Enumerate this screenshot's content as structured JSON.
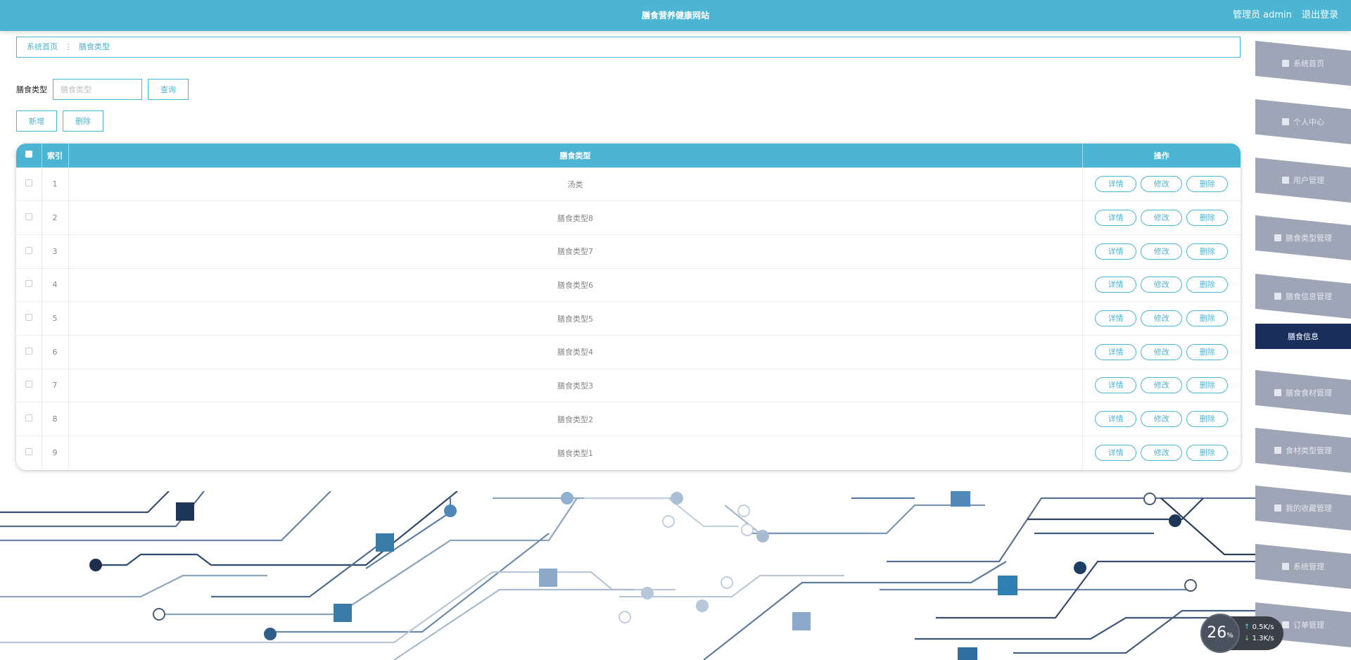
{
  "header": {
    "title": "膳食营养健康网站",
    "user": "管理员 admin",
    "logout": "退出登录"
  },
  "breadcrumb": {
    "home": "系统首页",
    "current": "膳食类型"
  },
  "search": {
    "label": "膳食类型",
    "placeholder": "膳食类型",
    "button": "查询"
  },
  "actions": {
    "add": "新增",
    "delete": "删除"
  },
  "table": {
    "headers": {
      "index": "索引",
      "type": "膳食类型",
      "ops": "操作"
    },
    "op_labels": {
      "detail": "详情",
      "edit": "修改",
      "delete": "删除"
    },
    "rows": [
      {
        "index": "1",
        "type": "汤类"
      },
      {
        "index": "2",
        "type": "膳食类型8"
      },
      {
        "index": "3",
        "type": "膳食类型7"
      },
      {
        "index": "4",
        "type": "膳食类型6"
      },
      {
        "index": "5",
        "type": "膳食类型5"
      },
      {
        "index": "6",
        "type": "膳食类型4"
      },
      {
        "index": "7",
        "type": "膳食类型3"
      },
      {
        "index": "8",
        "type": "膳食类型2"
      },
      {
        "index": "9",
        "type": "膳食类型1"
      }
    ]
  },
  "sidebar": {
    "items": [
      {
        "label": "系统首页",
        "icon": "home-icon"
      },
      {
        "label": "个人中心",
        "icon": "user-icon"
      },
      {
        "label": "用户管理",
        "icon": "briefcase-icon"
      },
      {
        "label": "膳食类型管理",
        "icon": "grid-icon"
      },
      {
        "label": "膳食信息管理",
        "icon": "grid-icon"
      },
      {
        "label": "膳食信息",
        "icon": "",
        "active": true
      },
      {
        "label": "膳食食材管理",
        "icon": "grid-icon"
      },
      {
        "label": "食材类型管理",
        "icon": "grid-icon"
      },
      {
        "label": "我的收藏管理",
        "icon": "clipboard-icon"
      },
      {
        "label": "系统管理",
        "icon": "list-icon"
      },
      {
        "label": "订单管理",
        "icon": "table-icon"
      }
    ]
  },
  "net_widget": {
    "percent": "26",
    "percent_unit": "%",
    "up": "0.5",
    "down": "1.3",
    "unit": "K/s"
  },
  "colors": {
    "primary": "#4bb5d3",
    "sidebar": "#9ea5b6",
    "sidebar_active": "#1a2e5c"
  }
}
